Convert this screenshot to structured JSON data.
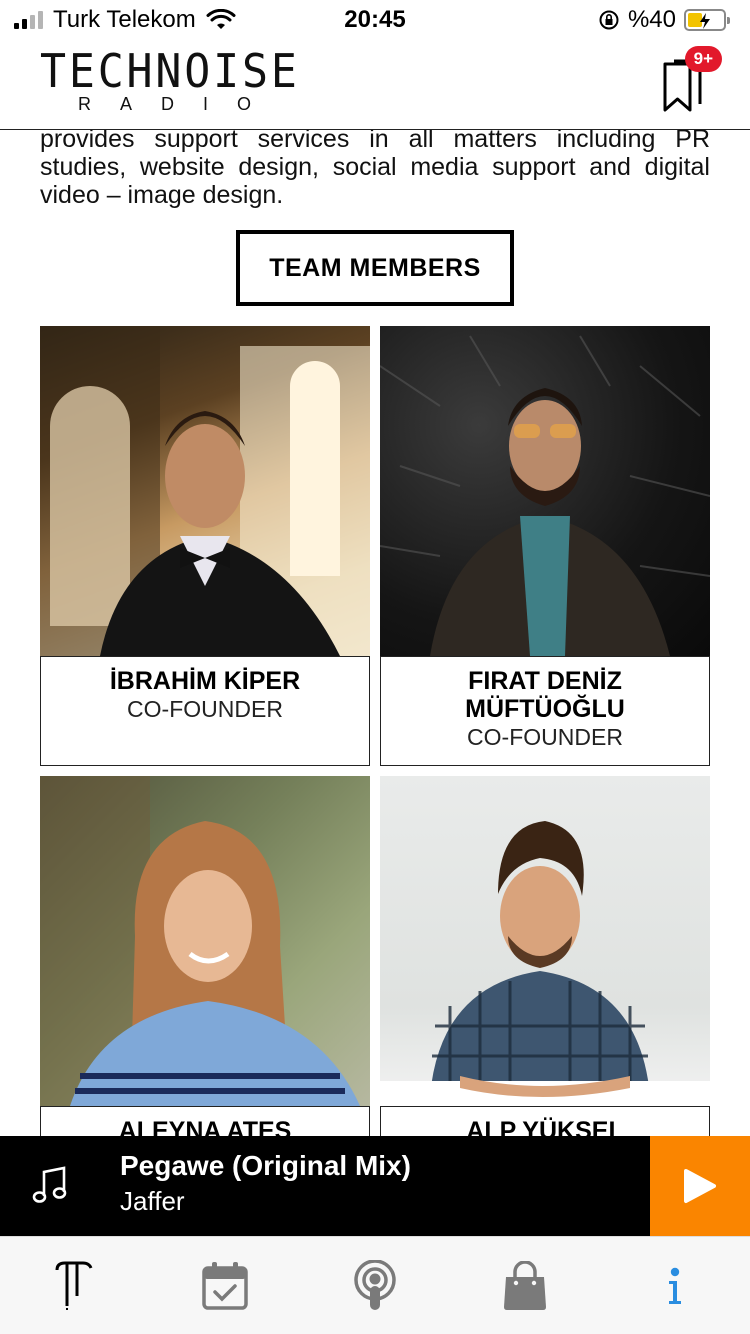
{
  "status_bar": {
    "carrier": "Turk Telekom",
    "time": "20:45",
    "battery_label": "%40",
    "battery_level": 0.4,
    "icons": [
      "signal-icon",
      "wifi-icon",
      "orientation-lock-icon",
      "battery-charging-icon"
    ]
  },
  "header": {
    "logo_main": "TECHNOISE",
    "logo_sub": "RADIO",
    "bookmark_badge": "9+"
  },
  "intro": {
    "text": "provides support services in all matters including PR studies, website design, social media support and digital video – image design."
  },
  "section_button": "TEAM MEMBERS",
  "team": [
    {
      "name": "İBRAHİM KİPER",
      "role": "CO-FOUNDER"
    },
    {
      "name": "FIRAT DENİZ MÜFTÜOĞLU",
      "role": "CO-FOUNDER"
    },
    {
      "name": "ALEYNA ATEŞ",
      "role": ""
    },
    {
      "name": "ALP YÜKSEL",
      "role": ""
    }
  ],
  "player": {
    "title": "Pegawe (Original Mix)",
    "artist": "Jaffer"
  },
  "tabs": [
    {
      "name": "home-logo-tab",
      "icon": "technoise-logo-icon"
    },
    {
      "name": "schedule-tab",
      "icon": "calendar-check-icon"
    },
    {
      "name": "podcast-tab",
      "icon": "podcast-icon"
    },
    {
      "name": "shop-tab",
      "icon": "shopping-bag-icon"
    },
    {
      "name": "info-tab",
      "icon": "info-icon",
      "active": true
    }
  ],
  "colors": {
    "accent_orange": "#fa8500",
    "badge_red": "#e2192b",
    "active_tab_blue": "#2a8de0",
    "tab_icon_gray": "#7a7a7a"
  }
}
